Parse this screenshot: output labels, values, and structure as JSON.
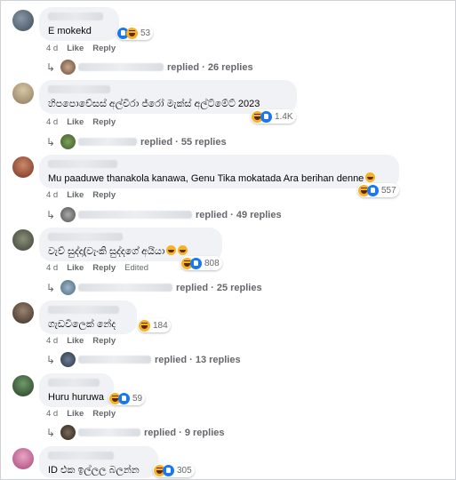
{
  "comments": [
    {
      "text": "E mokekd",
      "time": "4 d",
      "like": "Like",
      "reply": "Reply",
      "edited": "",
      "reaction_count": "53",
      "replies": "replied · 26 replies"
    },
    {
      "text": "හිපපොවේසස් අල්විරා ජ්රෝ මැක්ස් අල්ට්මේට් 2023",
      "time": "4 d",
      "like": "Like",
      "reply": "Reply",
      "edited": "",
      "reaction_count": "1.4K",
      "replies": "replied · 55 replies"
    },
    {
      "text": "Mu paaduwe thanakola kanawa, Genu Tika mokatada Ara berihan denne",
      "time": "4 d",
      "like": "Like",
      "reply": "Reply",
      "edited": "",
      "reaction_count": "557",
      "replies": "replied · 49 replies"
    },
    {
      "text": "වැව් සුද්දා(වැංකි සුද්දගේ අයියා",
      "time": "4 d",
      "like": "Like",
      "reply": "Reply",
      "edited": "Edited",
      "reaction_count": "808",
      "replies": "replied · 25 replies"
    },
    {
      "text": "ගැඩවිලෙක් නේද",
      "time": "4 d",
      "like": "Like",
      "reply": "Reply",
      "edited": "",
      "reaction_count": "184",
      "replies": "replied · 13 replies"
    },
    {
      "text": "Huru huruwa",
      "time": "4 d",
      "like": "Like",
      "reply": "Reply",
      "edited": "",
      "reaction_count": "59",
      "replies": "replied · 9 replies"
    },
    {
      "text": "ID එක ඉල්ලල බලන්න",
      "time": "",
      "like": "",
      "reply": "",
      "edited": "",
      "reaction_count": "305",
      "replies": ""
    }
  ],
  "colors": {
    "like_blue": "#1877f2",
    "haha_yellow": "#f7b125",
    "bubble_bg": "#f0f2f5",
    "meta_gray": "#65676b"
  }
}
